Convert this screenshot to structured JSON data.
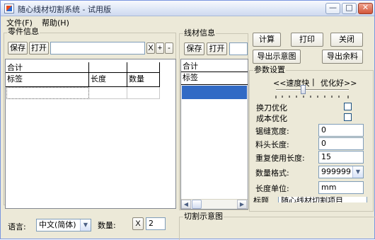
{
  "window": {
    "title": "随心线材切割系统 - 试用版",
    "min_glyph": "—",
    "max_glyph": "□",
    "close_glyph": "✕"
  },
  "menu": [
    "文件(F)",
    "帮助(H)"
  ],
  "parts_panel": {
    "title": "零件信息",
    "save_label": "保存",
    "open_label": "打开",
    "path_value": "",
    "x_label": "X",
    "plus_label": "+",
    "minus_label": "-",
    "total_label": "合计",
    "columns": [
      "标签",
      "长度",
      "数量"
    ]
  },
  "stock_panel": {
    "title": "线材信息",
    "save_label": "保存",
    "open_label": "打开",
    "total_label": "合计",
    "column": "标签"
  },
  "actions": {
    "compute": "计算",
    "print": "打印",
    "close": "关闭",
    "export_diagram": "导出示意图",
    "export_remnant": "导出余料"
  },
  "params": {
    "title": "参数设置",
    "speed_left": "<<速度快",
    "speed_sep": "|",
    "speed_right": "优化好>>",
    "tool_change": "换刀优化",
    "cost": "成本优化",
    "kerf_label": "锯缝宽度:",
    "kerf_value": "0",
    "head_label": "料头长度:",
    "head_value": "0",
    "reuse_label": "重复使用长度:",
    "reuse_value": "15",
    "format_label": "数量格式:",
    "format_value": "999999",
    "unit_label": "长度单位:",
    "unit_value": "mm",
    "cut_label": "标题",
    "cut_value": "随心线材切割项目"
  },
  "bottom": {
    "language_label": "语言:",
    "language_value": "中文(简体)",
    "qty_label": "数量:",
    "x_label": "X",
    "qty_value": "2",
    "diagram_title": "切割示意图"
  },
  "glyphs": {
    "scroll_left": "◀",
    "scroll_right": "▶",
    "dropdown": "▼"
  }
}
